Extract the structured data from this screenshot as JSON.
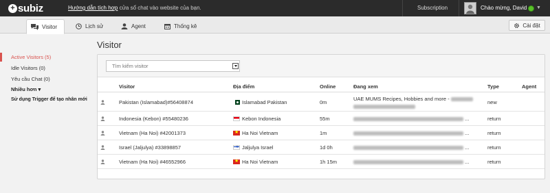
{
  "topbar": {
    "logo_text": "subiz",
    "notice_link": "Hướng dẫn tích hợp",
    "notice_text": " cửa sổ chat vào website của bạn.",
    "subscription": "Subscription",
    "greeting": "Chào mừng, David",
    "status_color": "#59c12a"
  },
  "tabs": [
    {
      "label": "Visitor",
      "icon": "chat-icon",
      "active": true
    },
    {
      "label": "Lịch sử",
      "icon": "clock-icon"
    },
    {
      "label": "Agent",
      "icon": "user-icon"
    },
    {
      "label": "Thống kê",
      "icon": "calendar-icon"
    }
  ],
  "settings_label": "Cài đặt",
  "sidebar": {
    "items": [
      {
        "label": "Active Visitors (5)"
      },
      {
        "label": "Idle Visitors (0)"
      },
      {
        "label": "Yêu cầu Chat (0)"
      },
      {
        "label": "Nhiều hơn ▾"
      },
      {
        "label": "Sử dụng Trigger để tạo nhân mới"
      }
    ]
  },
  "page_title": "Visitor",
  "search": {
    "placeholder": "Tìm kiếm visitor"
  },
  "table": {
    "headers": [
      "Visitor",
      "Địa điểm",
      "Online",
      "Đang xem",
      "Type",
      "Agent"
    ],
    "rows": [
      {
        "visitor": "Pakistan (Islamabad)#56408874",
        "flag": "pk",
        "location": "Islamabad Pakistan",
        "online": "0m",
        "viewing_line1": "UAE MUMS Recipes, Hobbies and more -",
        "viewing_line2": "",
        "type": "new",
        "agent": ""
      },
      {
        "visitor": "Indonesia (Kebon) #55480236",
        "flag": "id",
        "location": "Kebon Indonesia",
        "online": "55m",
        "viewing_line1": "...",
        "type": "return",
        "agent": ""
      },
      {
        "visitor": "Vietnam (Ha Noi) #42001373",
        "flag": "vn",
        "location": "Ha Noi Vietnam",
        "online": "1m",
        "viewing_line1": "...",
        "type": "return",
        "agent": ""
      },
      {
        "visitor": "Israel (Jaljulya) #33898857",
        "flag": "il",
        "location": "Jaljulya Israel",
        "online": "1d 0h",
        "viewing_line1": "...",
        "type": "return",
        "agent": ""
      },
      {
        "visitor": "Vietnam (Ha Noi) #46552966",
        "flag": "vn",
        "location": "Ha Noi Vietnam",
        "online": "1h 15m",
        "viewing_line1": "...",
        "type": "return",
        "agent": ""
      }
    ]
  }
}
